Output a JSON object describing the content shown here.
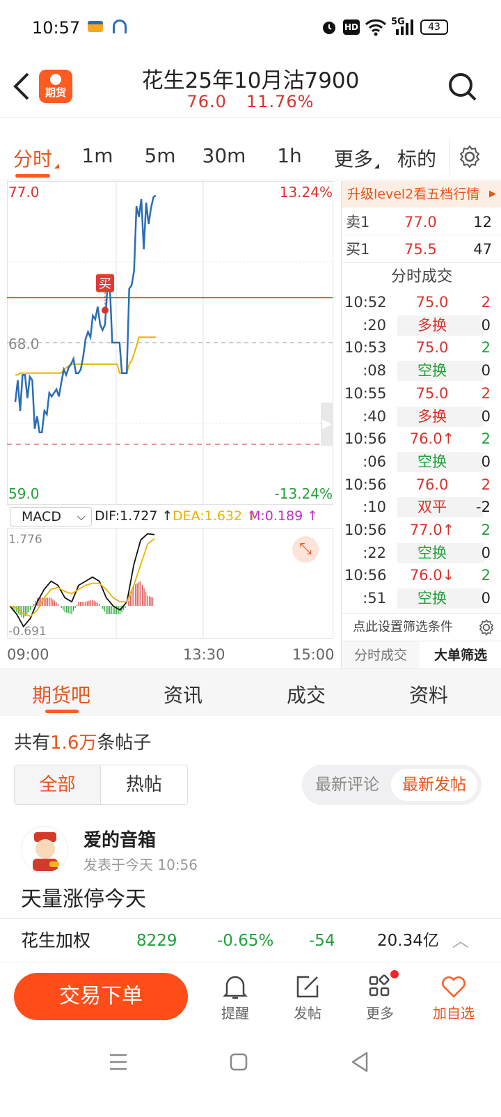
{
  "status_bar": {
    "time": "10:57",
    "battery": "43",
    "network": "5G"
  },
  "header": {
    "title": "花生25年10月沽7900",
    "price": "76.0",
    "change_pct": "11.76%",
    "logo_label": "期货"
  },
  "tabs": [
    {
      "label": "分时",
      "active": true
    },
    {
      "label": "1m"
    },
    {
      "label": "5m"
    },
    {
      "label": "30m"
    },
    {
      "label": "1h"
    },
    {
      "label": "更多"
    },
    {
      "label": "标的"
    }
  ],
  "chart": {
    "y_top": "77.0",
    "y_mid": "68.0",
    "y_bottom": "59.0",
    "pct_top": "13.24%",
    "pct_bottom": "-13.24%",
    "buy_marker": "买",
    "macd_select": "MACD",
    "dif": "DIF:1.727",
    "dea": "DEA:1.632",
    "m": "M:0.189",
    "macd_top": "1.776",
    "macd_bottom": "-0.691",
    "x_labels": [
      "09:00",
      "13:30",
      "15:00"
    ]
  },
  "chart_data": {
    "type": "line",
    "title": "",
    "ylim": [
      59.0,
      77.0
    ],
    "prev_close": 68.0,
    "buy_price": 70.5,
    "x": [
      "09:00",
      "13:30",
      "15:00"
    ],
    "series": [
      {
        "values": [
          64.7,
          65.9,
          64.2,
          66.2,
          66.2,
          64.9,
          66.1,
          65.9,
          63.2,
          63.9,
          63.0,
          63.0,
          64.2,
          64.0,
          65.2,
          65.0,
          65.2,
          65.4,
          65.0,
          65.8,
          66.5,
          66.2,
          66.6,
          66.8,
          67.1,
          66.3,
          66.3,
          66.5,
          67.2,
          68.2,
          68.6,
          68.3,
          69.5,
          69.3,
          70.0,
          69.0,
          68.7,
          69.0,
          71.0,
          71.2,
          68.0,
          68.0,
          68.0,
          68.0,
          66.3,
          66.3,
          66.3,
          71.0,
          71.2,
          72.0,
          75.6,
          75.0,
          76.0,
          73.2,
          75.8,
          74.6,
          75.5,
          76.1,
          76.2
        ]
      },
      {
        "values": [
          66.2,
          66.2,
          66.3,
          66.3,
          66.3,
          66.3,
          66.3,
          66.3,
          66.3,
          66.3,
          66.3,
          66.3,
          66.3,
          66.3,
          66.3,
          66.3,
          66.3,
          66.3,
          66.3,
          66.3,
          66.5,
          66.6,
          66.7,
          66.8,
          66.8,
          66.8,
          66.8,
          66.8,
          66.8,
          66.8,
          66.8,
          66.8,
          66.8,
          66.8,
          66.8,
          66.8,
          66.8,
          66.8,
          66.8,
          66.8,
          66.8,
          66.8,
          66.8,
          66.3,
          66.3,
          66.3,
          66.3,
          66.8,
          67.0,
          67.4,
          67.8,
          68.3,
          68.3,
          68.3,
          68.3,
          68.3,
          68.3,
          68.3,
          68.3
        ]
      }
    ],
    "macd": {
      "ylim": [
        -0.691,
        1.776
      ],
      "dif": [
        0.0,
        -0.2,
        -0.5,
        -0.3,
        0.1,
        0.4,
        0.6,
        0.5,
        0.2,
        0.1,
        0.5,
        0.6,
        0.7,
        0.6,
        0.2,
        0.0,
        -0.1,
        0.1,
        1.0,
        1.6,
        1.75,
        1.73
      ],
      "dea": [
        0.0,
        -0.05,
        -0.2,
        -0.25,
        -0.1,
        0.2,
        0.4,
        0.45,
        0.35,
        0.3,
        0.4,
        0.5,
        0.55,
        0.55,
        0.4,
        0.2,
        0.1,
        0.1,
        0.5,
        1.0,
        1.5,
        1.63
      ],
      "m": [
        -0.0,
        -0.15,
        -0.3,
        -0.1,
        0.2,
        0.2,
        0.2,
        0.05,
        -0.15,
        -0.2,
        0.1,
        0.1,
        0.15,
        0.05,
        -0.2,
        -0.2,
        -0.2,
        0.0,
        0.5,
        0.6,
        0.25,
        0.19
      ]
    }
  },
  "order_book": {
    "upgrade": "升级level2看五档行情",
    "sell_label": "卖1",
    "sell_price": "77.0",
    "sell_qty": "12",
    "buy_label": "买1",
    "buy_price": "75.5",
    "buy_qty": "47",
    "trades_title": "分时成交",
    "trades": [
      {
        "time": "10:52",
        "price": "75.0",
        "vol": "2",
        "pcolor": "red",
        "vcolor": "red"
      },
      {
        "time": ":20",
        "price": "多换",
        "vol": "0",
        "pcolor": "red",
        "vcolor": "dark",
        "bg": true
      },
      {
        "time": "10:53",
        "price": "75.0",
        "vol": "2",
        "pcolor": "red",
        "vcolor": "green"
      },
      {
        "time": ":08",
        "price": "空换",
        "vol": "0",
        "pcolor": "green",
        "vcolor": "dark",
        "bg": true
      },
      {
        "time": "10:55",
        "price": "75.0",
        "vol": "2",
        "pcolor": "red",
        "vcolor": "red"
      },
      {
        "time": ":40",
        "price": "多换",
        "vol": "0",
        "pcolor": "red",
        "vcolor": "dark",
        "bg": true
      },
      {
        "time": "10:56",
        "price": "76.0↑",
        "vol": "2",
        "pcolor": "red",
        "vcolor": "green"
      },
      {
        "time": ":06",
        "price": "空换",
        "vol": "0",
        "pcolor": "green",
        "vcolor": "dark",
        "bg": true
      },
      {
        "time": "10:56",
        "price": "76.0",
        "vol": "2",
        "pcolor": "red",
        "vcolor": "red"
      },
      {
        "time": ":10",
        "price": "双平",
        "vol": "-2",
        "pcolor": "red",
        "vcolor": "dark",
        "bg": true
      },
      {
        "time": "10:56",
        "price": "77.0↑",
        "vol": "2",
        "pcolor": "red",
        "vcolor": "green"
      },
      {
        "time": ":22",
        "price": "空换",
        "vol": "0",
        "pcolor": "green",
        "vcolor": "dark",
        "bg": true
      },
      {
        "time": "10:56",
        "price": "76.0↓",
        "vol": "2",
        "pcolor": "red",
        "vcolor": "green"
      },
      {
        "time": ":51",
        "price": "空换",
        "vol": "0",
        "pcolor": "green",
        "vcolor": "dark",
        "bg": true
      }
    ],
    "filter_text": "点此设置筛选条件",
    "tab_a": "分时成交",
    "tab_b": "大单筛选"
  },
  "section_tabs": [
    "期货吧",
    "资讯",
    "成交",
    "资料"
  ],
  "forum": {
    "count_prefix": "共有",
    "count_num": "1.6万",
    "count_suffix": "条帖子",
    "seg_all": "全部",
    "seg_hot": "热帖",
    "sort_comment": "最新评论",
    "sort_post": "最新发帖",
    "post_user": "爱的音箱",
    "post_time": "发表于今天 10:56",
    "post_text": "天量涨停今天"
  },
  "ticker": {
    "name": "花生加权",
    "price": "8229",
    "pct": "-0.65%",
    "change": "-54",
    "volume": "20.34亿"
  },
  "bottom_bar": {
    "trade": "交易下单",
    "remind": "提醒",
    "post": "发帖",
    "more": "更多",
    "fav": "加自选"
  },
  "colors": {
    "accent": "#ff5a1f",
    "up": "#d8322b",
    "down": "#22a03a",
    "price_line": "#2a6db5",
    "avg_line": "#e8b200"
  }
}
